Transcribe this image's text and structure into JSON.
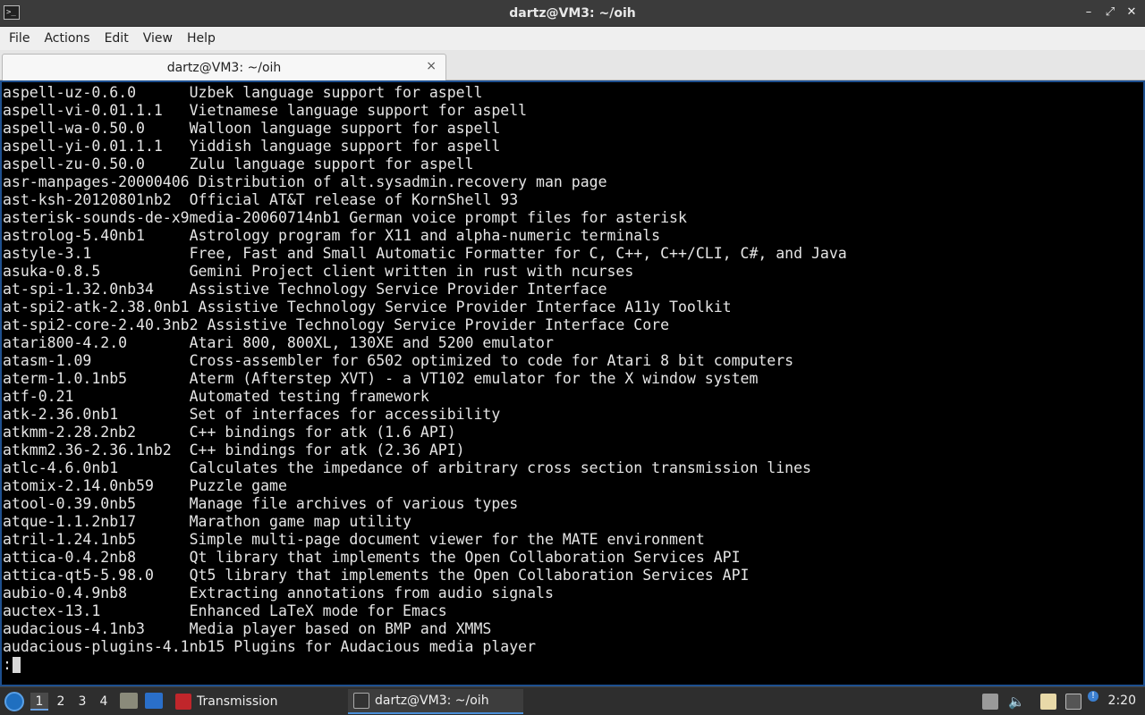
{
  "window": {
    "title": "dartz@VM3: ~/oih",
    "app_icon_label": ">_",
    "controls": {
      "minimize": "–",
      "maximize": "⤢",
      "close": "✕"
    }
  },
  "menubar": [
    "File",
    "Actions",
    "Edit",
    "View",
    "Help"
  ],
  "tab": {
    "label": "dartz@VM3: ~/oih",
    "close": "×"
  },
  "terminal": {
    "lines": [
      "aspell-uz-0.6.0      Uzbek language support for aspell",
      "aspell-vi-0.01.1.1   Vietnamese language support for aspell",
      "aspell-wa-0.50.0     Walloon language support for aspell",
      "aspell-yi-0.01.1.1   Yiddish language support for aspell",
      "aspell-zu-0.50.0     Zulu language support for aspell",
      "asr-manpages-20000406 Distribution of alt.sysadmin.recovery man page",
      "ast-ksh-20120801nb2  Official AT&T release of KornShell 93",
      "asterisk-sounds-de-x9media-20060714nb1 German voice prompt files for asterisk",
      "astrolog-5.40nb1     Astrology program for X11 and alpha-numeric terminals",
      "astyle-3.1           Free, Fast and Small Automatic Formatter for C, C++, C++/CLI, C#, and Java",
      "asuka-0.8.5          Gemini Project client written in rust with ncurses",
      "at-spi-1.32.0nb34    Assistive Technology Service Provider Interface",
      "at-spi2-atk-2.38.0nb1 Assistive Technology Service Provider Interface A11y Toolkit",
      "at-spi2-core-2.40.3nb2 Assistive Technology Service Provider Interface Core",
      "atari800-4.2.0       Atari 800, 800XL, 130XE and 5200 emulator",
      "atasm-1.09           Cross-assembler for 6502 optimized to code for Atari 8 bit computers",
      "aterm-1.0.1nb5       Aterm (Afterstep XVT) - a VT102 emulator for the X window system",
      "atf-0.21             Automated testing framework",
      "atk-2.36.0nb1        Set of interfaces for accessibility",
      "atkmm-2.28.2nb2      C++ bindings for atk (1.6 API)",
      "atkmm2.36-2.36.1nb2  C++ bindings for atk (2.36 API)",
      "atlc-4.6.0nb1        Calculates the impedance of arbitrary cross section transmission lines",
      "atomix-2.14.0nb59    Puzzle game",
      "atool-0.39.0nb5      Manage file archives of various types",
      "atque-1.1.2nb17      Marathon game map utility",
      "atril-1.24.1nb5      Simple multi-page document viewer for the MATE environment",
      "attica-0.4.2nb8      Qt library that implements the Open Collaboration Services API",
      "attica-qt5-5.98.0    Qt5 library that implements the Open Collaboration Services API",
      "aubio-0.4.9nb8       Extracting annotations from audio signals",
      "auctex-13.1          Enhanced LaTeX mode for Emacs",
      "audacious-4.1nb3     Media player based on BMP and XMMS",
      "audacious-plugins-4.1nb15 Plugins for Audacious media player"
    ],
    "prompt": ":"
  },
  "taskbar": {
    "workspaces": [
      "1",
      "2",
      "3",
      "4"
    ],
    "tasks": [
      {
        "label": "Transmission",
        "icon": "transmission-icon"
      },
      {
        "label": "dartz@VM3: ~/oih",
        "icon": "terminal-icon"
      }
    ],
    "tray_badge": "!",
    "clock": "2:20"
  }
}
